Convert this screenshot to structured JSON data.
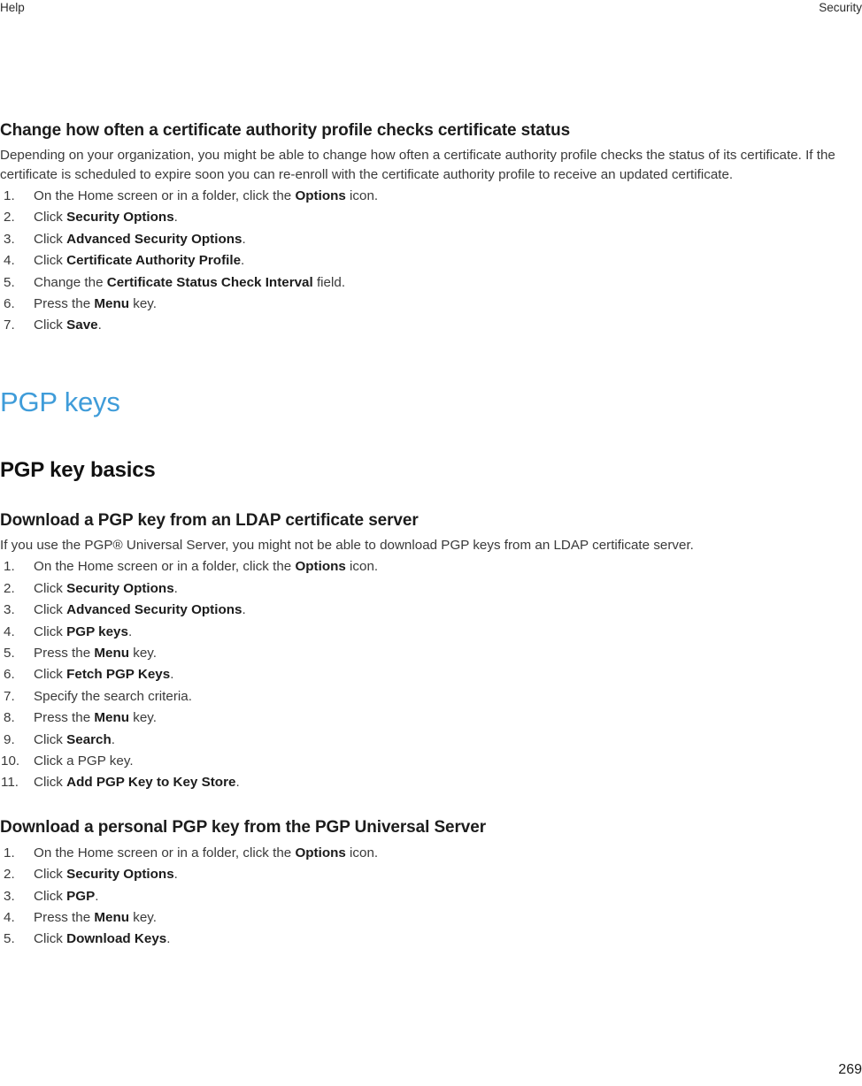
{
  "header": {
    "left": "Help",
    "right": "Security"
  },
  "footer": {
    "page_number": "269"
  },
  "colors": {
    "chapter_heading": "#3f9cd9",
    "body_text": "#3a3a3a",
    "heading_text": "#1c1c1c",
    "page_background": "#ffffff"
  },
  "sections": {
    "ca_profile": {
      "heading": "Change how often a certificate authority profile checks certificate status",
      "intro": "Depending on your organization, you might be able to change how often a certificate authority profile checks the status of its certificate. If the certificate is scheduled to expire soon you can re-enroll with the certificate authority profile to receive an updated certificate.",
      "steps": [
        {
          "pre": "On the Home screen or in a folder, click the ",
          "bold": "Options",
          "post": " icon."
        },
        {
          "pre": "Click ",
          "bold": "Security Options",
          "post": "."
        },
        {
          "pre": "Click ",
          "bold": "Advanced Security Options",
          "post": "."
        },
        {
          "pre": "Click ",
          "bold": "Certificate Authority Profile",
          "post": "."
        },
        {
          "pre": "Change the ",
          "bold": "Certificate Status Check Interval",
          "post": " field."
        },
        {
          "pre": "Press the ",
          "bold": "Menu",
          "post": " key."
        },
        {
          "pre": "Click ",
          "bold": "Save",
          "post": "."
        }
      ]
    },
    "chapter": {
      "title": "PGP keys"
    },
    "pgp_key_basics": {
      "title": "PGP key basics"
    },
    "download_ldap": {
      "heading": "Download a PGP key from an LDAP certificate server",
      "intro": "If you use the PGP® Universal Server, you might not be able to download PGP keys from an LDAP certificate server.",
      "steps": [
        {
          "pre": "On the Home screen or in a folder, click the ",
          "bold": "Options",
          "post": " icon."
        },
        {
          "pre": "Click ",
          "bold": "Security Options",
          "post": "."
        },
        {
          "pre": "Click ",
          "bold": "Advanced Security Options",
          "post": "."
        },
        {
          "pre": "Click ",
          "bold": "PGP keys",
          "post": "."
        },
        {
          "pre": "Press the ",
          "bold": "Menu",
          "post": " key."
        },
        {
          "pre": "Click ",
          "bold": "Fetch PGP Keys",
          "post": "."
        },
        {
          "pre": "Specify the search criteria.",
          "bold": "",
          "post": ""
        },
        {
          "pre": "Press the ",
          "bold": "Menu",
          "post": " key."
        },
        {
          "pre": "Click ",
          "bold": "Search",
          "post": "."
        },
        {
          "pre": "Click a PGP key.",
          "bold": "",
          "post": ""
        },
        {
          "pre": "Click ",
          "bold": "Add PGP Key to Key Store",
          "post": "."
        }
      ]
    },
    "download_personal": {
      "heading": "Download a personal PGP key from the PGP Universal Server",
      "steps": [
        {
          "pre": "On the Home screen or in a folder, click the ",
          "bold": "Options",
          "post": " icon."
        },
        {
          "pre": "Click ",
          "bold": "Security Options",
          "post": "."
        },
        {
          "pre": "Click ",
          "bold": "PGP",
          "post": "."
        },
        {
          "pre": "Press the ",
          "bold": "Menu",
          "post": " key."
        },
        {
          "pre": "Click ",
          "bold": "Download Keys",
          "post": "."
        }
      ]
    }
  }
}
